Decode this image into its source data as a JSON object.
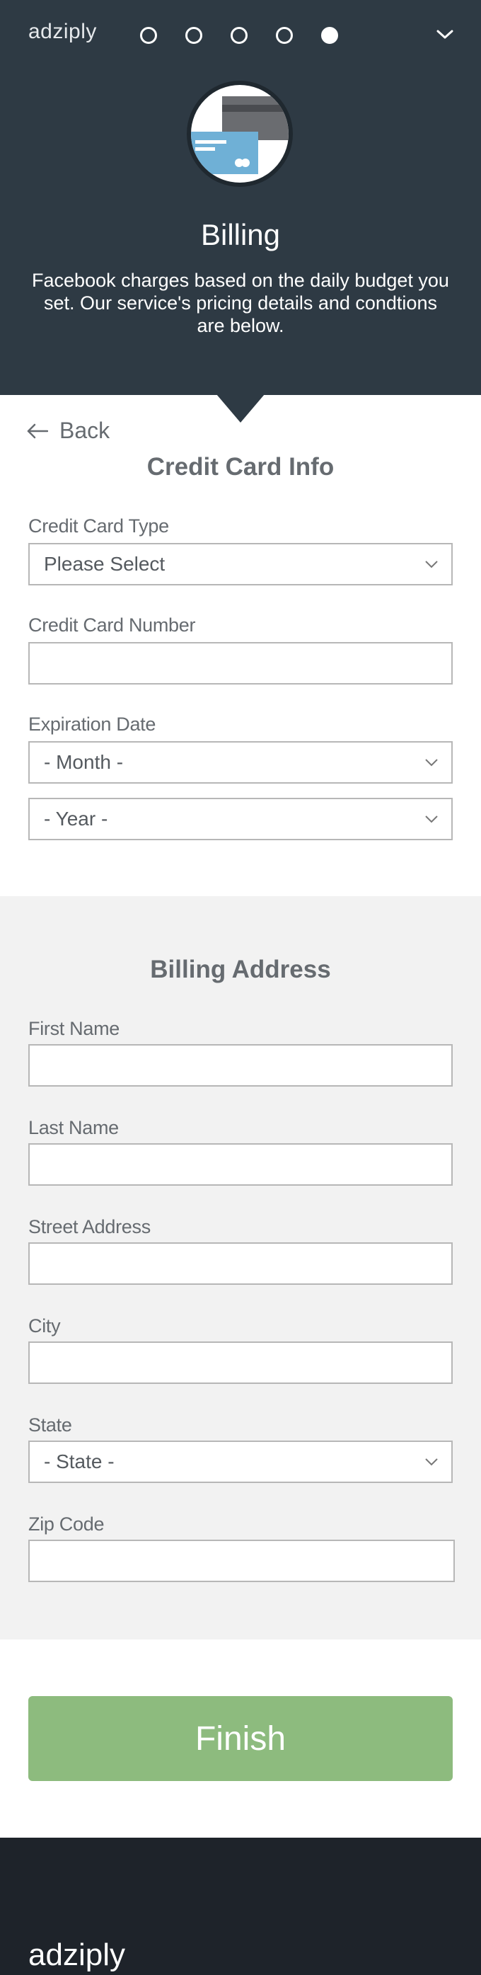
{
  "header": {
    "brand": "adziply",
    "steps_total": 5,
    "steps_current": 5,
    "title": "Billing",
    "description": "Facebook charges based on the daily budget you set. Our service's pricing details and condtions are below."
  },
  "nav": {
    "back_label": "Back"
  },
  "credit_card": {
    "section_title": "Credit Card Info",
    "type_label": "Credit Card Type",
    "type_value": "Please Select",
    "number_label": "Credit Card Number",
    "number_value": "",
    "expiration_label": "Expiration Date",
    "month_value": "- Month -",
    "year_value": "- Year -"
  },
  "billing_address": {
    "section_title": "Billing Address",
    "first_name_label": "First Name",
    "first_name_value": "",
    "last_name_label": "Last Name",
    "last_name_value": "",
    "street_label": "Street Address",
    "street_value": "",
    "city_label": "City",
    "city_value": "",
    "state_label": "State",
    "state_value": "- State -",
    "zip_label": "Zip Code",
    "zip_value": ""
  },
  "actions": {
    "finish_label": "Finish"
  },
  "footer": {
    "brand": "adziply"
  },
  "colors": {
    "header_bg": "#2e3a44",
    "footer_bg": "#1e232a",
    "panel_bg": "#f2f2f2",
    "finish_bg": "#8dbb7e",
    "card_blue": "#6fb0d6"
  },
  "icons": {
    "hero": "credit-card-icon",
    "menu": "chevron-down-icon",
    "back": "arrow-left-icon",
    "select": "chevron-down-icon"
  }
}
